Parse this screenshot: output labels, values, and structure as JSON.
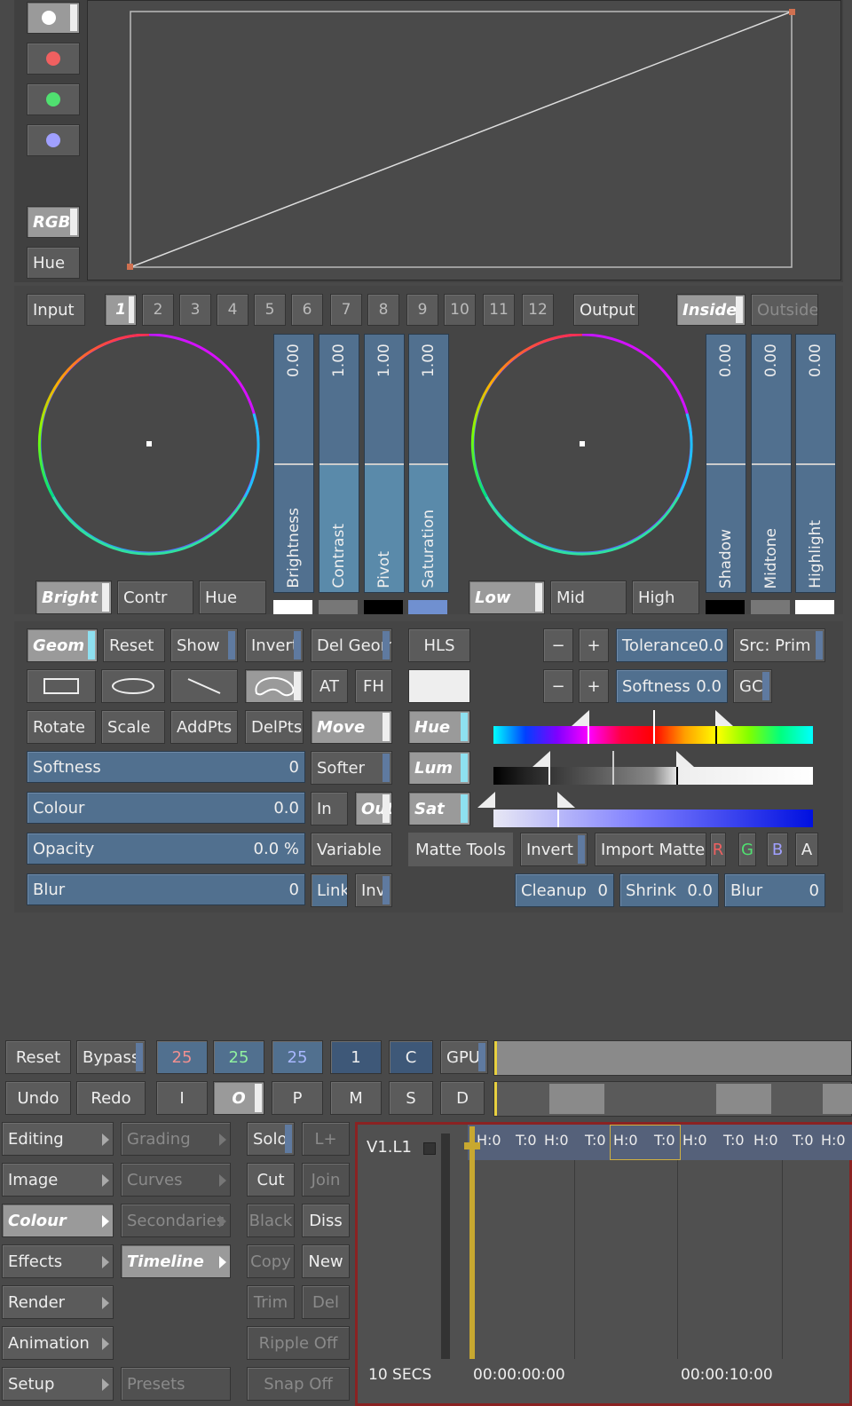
{
  "curves": {
    "channel_buttons": [
      "white-dot",
      "red-dot",
      "green-dot",
      "blue-dot"
    ],
    "mode_buttons": [
      "RGB",
      "Hue"
    ]
  },
  "strip": {
    "input_label": "Input",
    "output_label": "Output",
    "numbers": [
      "1",
      "2",
      "3",
      "4",
      "5",
      "6",
      "7",
      "8",
      "9",
      "10",
      "11",
      "12"
    ],
    "inside_label": "Inside",
    "outside_label": "Outside"
  },
  "left_wheel": {
    "sliders": [
      {
        "value": "0.00",
        "label": "Brightness"
      },
      {
        "value": "1.00",
        "label": "Contrast"
      },
      {
        "value": "1.00",
        "label": "Pivot"
      },
      {
        "value": "1.00",
        "label": "Saturation"
      }
    ],
    "buttons": [
      "Bright",
      "Contr",
      "Hue"
    ]
  },
  "right_wheel": {
    "sliders": [
      {
        "value": "0.00",
        "label": "Shadow"
      },
      {
        "value": "0.00",
        "label": "Midtone"
      },
      {
        "value": "0.00",
        "label": "Highlight"
      }
    ],
    "buttons": [
      "Low",
      "Mid",
      "High"
    ]
  },
  "geom": {
    "row1": [
      "Geom",
      "Reset",
      "Show",
      "Invert"
    ],
    "row3": [
      "Rotate",
      "Scale",
      "AddPts",
      "DelPts"
    ],
    "del_geom": "Del Geom",
    "at": "AT",
    "fh": "FH",
    "move": "Move",
    "softer": "Softer",
    "in": "In",
    "out": "Out",
    "variable": "Variable",
    "link": "Link",
    "inv": "Inv",
    "fields": [
      {
        "label": "Softness",
        "value": "0"
      },
      {
        "label": "Colour",
        "value": "0.0"
      },
      {
        "label": "Opacity",
        "value": "0.0 %"
      },
      {
        "label": "Blur",
        "value": "0"
      }
    ]
  },
  "hls": {
    "hls_button": "HLS",
    "channels": [
      "Hue",
      "Lum",
      "Sat"
    ],
    "minus": "−",
    "plus": "+",
    "tolerance_label": "Tolerance",
    "tolerance_value": "0.0",
    "softness_label": "Softness",
    "softness_value": "0.0",
    "src": "Src: Prim",
    "gc": "GC",
    "matte_tools": "Matte Tools",
    "invert": "Invert",
    "import_matte": "Import Matte",
    "rgba": [
      "R",
      "G",
      "B",
      "A"
    ],
    "cleanup_label": "Cleanup",
    "cleanup_value": "0",
    "shrink_label": "Shrink",
    "shrink_value": "0.0",
    "blur_label": "Blur",
    "blur_value": "0"
  },
  "transport": {
    "reset": "Reset",
    "bypass": "Bypass",
    "r": "25",
    "g": "25",
    "b": "25",
    "one": "1",
    "c": "C",
    "gpu": "GPU",
    "undo": "Undo",
    "redo": "Redo",
    "i": "I",
    "o": "O",
    "p": "P",
    "m": "M",
    "s": "S",
    "d": "D"
  },
  "menu": {
    "col1": [
      "Editing",
      "Image",
      "Colour",
      "Effects",
      "Render",
      "Animation",
      "Setup"
    ],
    "col2": [
      "Grading",
      "Curves",
      "Secondaries",
      "Timeline",
      "Presets"
    ],
    "solo": "Solo",
    "lplus": "L+",
    "cut": "Cut",
    "join": "Join",
    "black": "Black",
    "diss": "Diss",
    "copy": "Copy",
    "new": "New",
    "trim": "Trim",
    "del": "Del",
    "ripple": "Ripple Off",
    "snap": "Snap Off"
  },
  "timeline": {
    "track": "V1.L1",
    "clip_labels": [
      "H:0",
      "T:0",
      "H:0",
      "T:0",
      "H:0",
      "T:0",
      "H:0",
      "T:0",
      "H:0",
      "T:0",
      "H:0"
    ],
    "scale": "10 SECS",
    "tc_start": "00:00:00:00",
    "tc_mid": "00:00:10:00"
  }
}
